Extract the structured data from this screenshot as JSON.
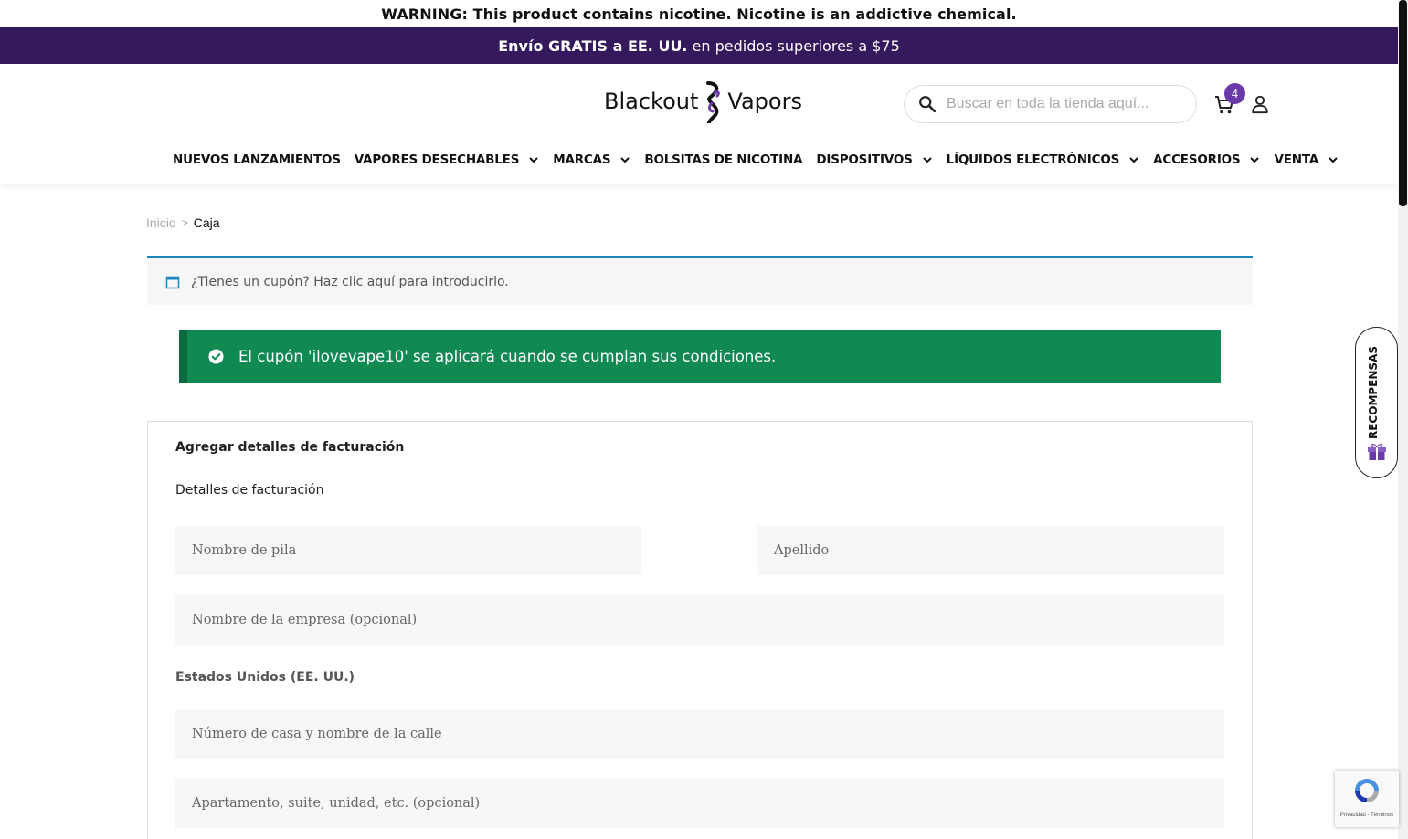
{
  "warning": "WARNING: This product contains nicotine. Nicotine is an addictive chemical.",
  "promo": {
    "bold": "Envío GRATIS a EE. UU.",
    "rest": "en pedidos superiores a $75"
  },
  "header": {
    "logo_left": "Blackout",
    "logo_right": "Vapors",
    "search_placeholder": "Buscar en toda la tienda aquí...",
    "cart_count": "4"
  },
  "nav": [
    {
      "label": "NUEVOS LANZAMIENTOS"
    },
    {
      "label": "VAPORES DESECHABLES"
    },
    {
      "label": "MARCAS"
    },
    {
      "label": "BOLSITAS DE NICOTINA"
    },
    {
      "label": "DISPOSITIVOS"
    },
    {
      "label": "LÍQUIDOS ELECTRÓNICOS"
    },
    {
      "label": "ACCESORIOS"
    },
    {
      "label": "VENTA"
    }
  ],
  "breadcrumb": {
    "home": "Inicio",
    "current": "Caja"
  },
  "coupon_prompt": "¿Tienes un cupón? Haz clic aquí para introducirlo.",
  "success_message": "El cupón 'ilovevape10' se aplicará cuando se cumplan sus condiciones.",
  "billing": {
    "title": "Agregar detalles de facturación",
    "subtitle": "Detalles de facturación",
    "first_name_placeholder": "Nombre de pila",
    "last_name_placeholder": "Apellido",
    "company_placeholder": "Nombre de la empresa (opcional)",
    "country": "Estados Unidos (EE. UU.)",
    "street_placeholder": "Número de casa y nombre de la calle",
    "apartment_placeholder": "Apartamento, suite, unidad, etc. (opcional)"
  },
  "rewards_label": "RECOMPENSAS",
  "recaptcha_terms": "Privacidad - Términos",
  "colors": {
    "promo_bg": "#34195c",
    "accent": "#6a3aa8",
    "success_bg": "#108a52",
    "coupon_border": "#1e85be"
  }
}
